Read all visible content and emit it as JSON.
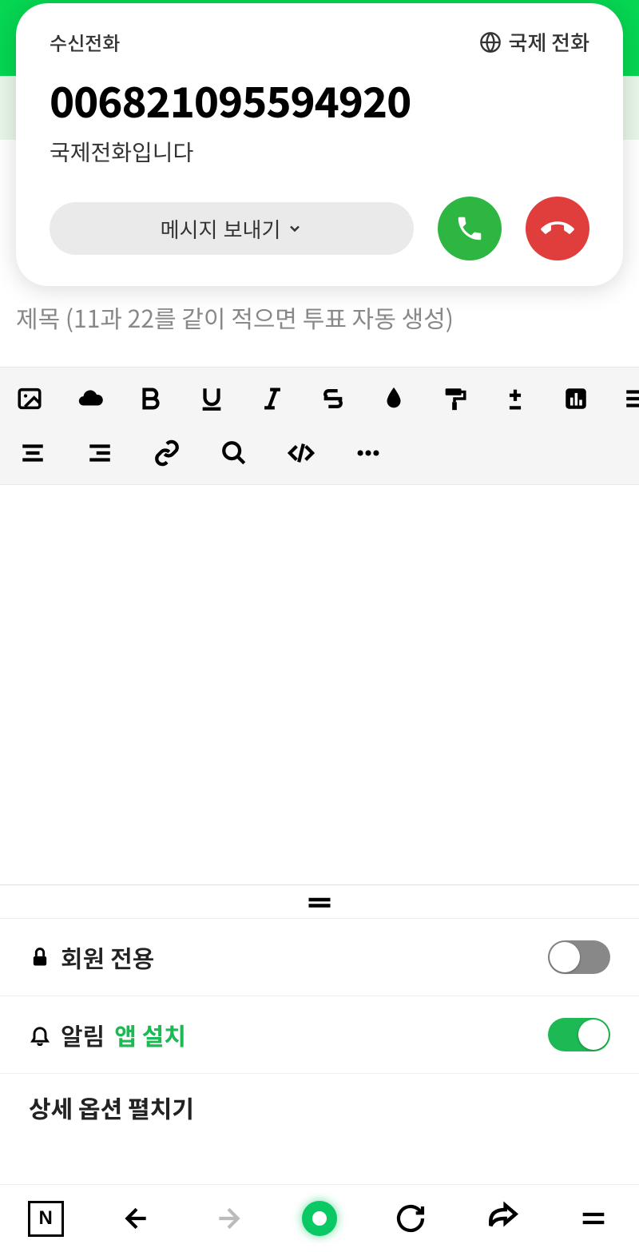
{
  "call": {
    "incoming_label": "수신전화",
    "intl_label": "국제 전화",
    "number": "006821095594920",
    "subtitle": "국제전화입니다",
    "msg_button": "메시지 보내기"
  },
  "editor": {
    "title_placeholder": "제목 (11과 22를 같이 적으면 투표 자동 생성)"
  },
  "toolbar": {
    "icons_row1": [
      "image-icon",
      "cloud-icon",
      "bold-icon",
      "underline-icon",
      "italic-icon",
      "strikethrough-icon",
      "fill-icon",
      "paint-roller-icon",
      "plusminus-icon",
      "chart-icon",
      "align-left-icon"
    ],
    "icons_row2": [
      "align-justify-icon",
      "align-right-icon",
      "link-icon",
      "search-icon",
      "code-icon",
      "more-icon"
    ]
  },
  "options": {
    "members_only": {
      "label": "회원 전용",
      "state": false
    },
    "notifications": {
      "label": "알림",
      "link": "앱 설치",
      "state": true
    },
    "partial_row": "상세 옵션 펼치기"
  },
  "nav": {
    "items": [
      "naver-icon",
      "back-icon",
      "forward-icon",
      "home-icon",
      "refresh-icon",
      "share-icon",
      "menu-icon"
    ]
  }
}
